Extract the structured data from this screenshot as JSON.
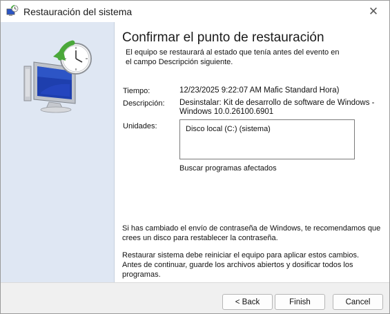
{
  "window": {
    "title": "Restauración del sistema",
    "close_glyph": "✕"
  },
  "page": {
    "heading": "Confirmar el punto de restauración",
    "intro_line1": "El equipo se restaurará al estado que tenía antes del evento en",
    "intro_line2": "el campo Descripción siguiente."
  },
  "fields": {
    "time_label": "Tiempo:",
    "time_value": "12/23/2025 9:22:07 AM Mafic Standard Hora)",
    "description_label": "Descripción:",
    "description_line1": "Desinstalar: Kit de desarrollo de software de Windows -",
    "description_line2": "Windows 10.0.26100.6901",
    "drives_label": "Unidades:",
    "drives": [
      "Disco local (C:) (sistema)"
    ]
  },
  "scan_link": "Buscar programas afectados",
  "notes": {
    "password_line1": "Si has cambiado el envío de contraseña de Windows, te recomendamos que",
    "password_line2": "crees un disco para restablecer la contraseña.",
    "restart_line1": "Restaurar sistema debe reiniciar el equipo para aplicar estos cambios.",
    "restart_line2": "Antes de continuar, guarde los archivos abiertos y dosificar todos los programas."
  },
  "buttons": {
    "back": "< Back",
    "finish": "Finish",
    "cancel": "Cancel"
  },
  "colors": {
    "left_panel": "#dfe7f3",
    "accent_green": "#4aa83a",
    "screen_blue": "#1e3fae"
  },
  "icons": {
    "title": "system-restore-icon",
    "hero": "restore-computer-clock-icon"
  }
}
